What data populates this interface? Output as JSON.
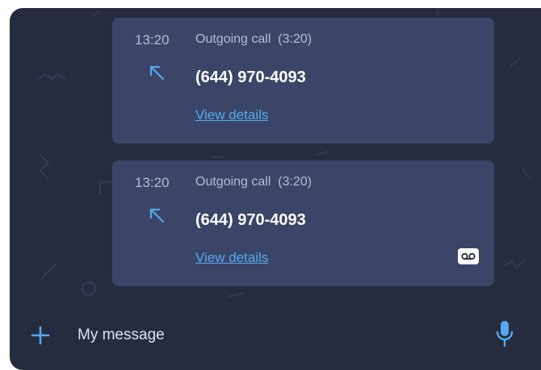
{
  "colors": {
    "panel_background": "#262c3e",
    "card_background": "#3b4568",
    "accent": "#55a9f0"
  },
  "calls": [
    {
      "time": "13:20",
      "type": "Outgoing call",
      "duration": "(3:20)",
      "direction_icon": "outgoing-arrow-icon",
      "phone": "(644) 970-4093",
      "details_label": "View details",
      "has_voicemail": false
    },
    {
      "time": "13:20",
      "type": "Outgoing call",
      "duration": "(3:20)",
      "direction_icon": "outgoing-arrow-icon",
      "phone": "(644) 970-4093",
      "details_label": "View details",
      "has_voicemail": true
    }
  ],
  "composer": {
    "add_icon": "plus-icon",
    "placeholder": "My message",
    "mic_icon": "microphone-icon"
  }
}
